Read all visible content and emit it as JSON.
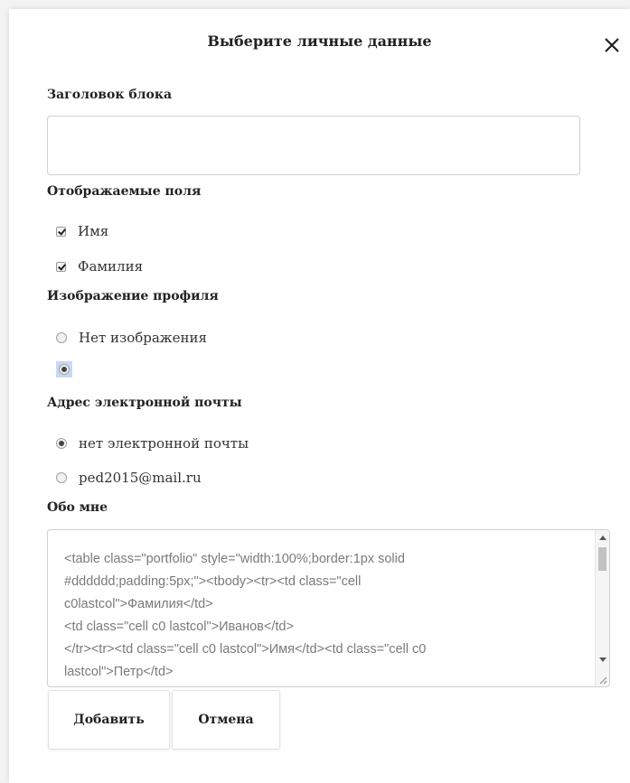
{
  "dialog": {
    "title": "Выберите личные данные",
    "close_icon": "close-icon"
  },
  "block_title": {
    "label": "Заголовок блока",
    "value": ""
  },
  "fields": {
    "label": "Отображаемые поля",
    "options": [
      {
        "label": "Имя",
        "checked": true
      },
      {
        "label": "Фамилия",
        "checked": true
      }
    ]
  },
  "profile_image": {
    "label": "Изображение профиля",
    "options": [
      {
        "label": "Нет изображения",
        "selected": false
      },
      {
        "label": "",
        "selected": true
      }
    ]
  },
  "email": {
    "label": "Адрес электронной почты",
    "options": [
      {
        "label": "нет электронной почты",
        "selected": true
      },
      {
        "label": "ped2015@mail.ru",
        "selected": false
      }
    ]
  },
  "about": {
    "label": "Обо мне",
    "value": "<table class=\"portfolio\" style=\"width:100%;border:1px solid\n#dddddd;padding:5px;\"><tbody><tr><td class=\"cell\nc0lastcol\">Фамилия</td>\n<td class=\"cell c0 lastcol\">Иванов</td>\n</tr><tr><td class=\"cell c0 lastcol\">Имя</td><td class=\"cell c0\nlastcol\">Петр</td>"
  },
  "buttons": {
    "add": "Добавить",
    "cancel": "Отмена"
  },
  "colors": {
    "focus_highlight": "#c9d7f7",
    "border": "#cfcfcf",
    "text_muted": "#7a7a7a"
  }
}
